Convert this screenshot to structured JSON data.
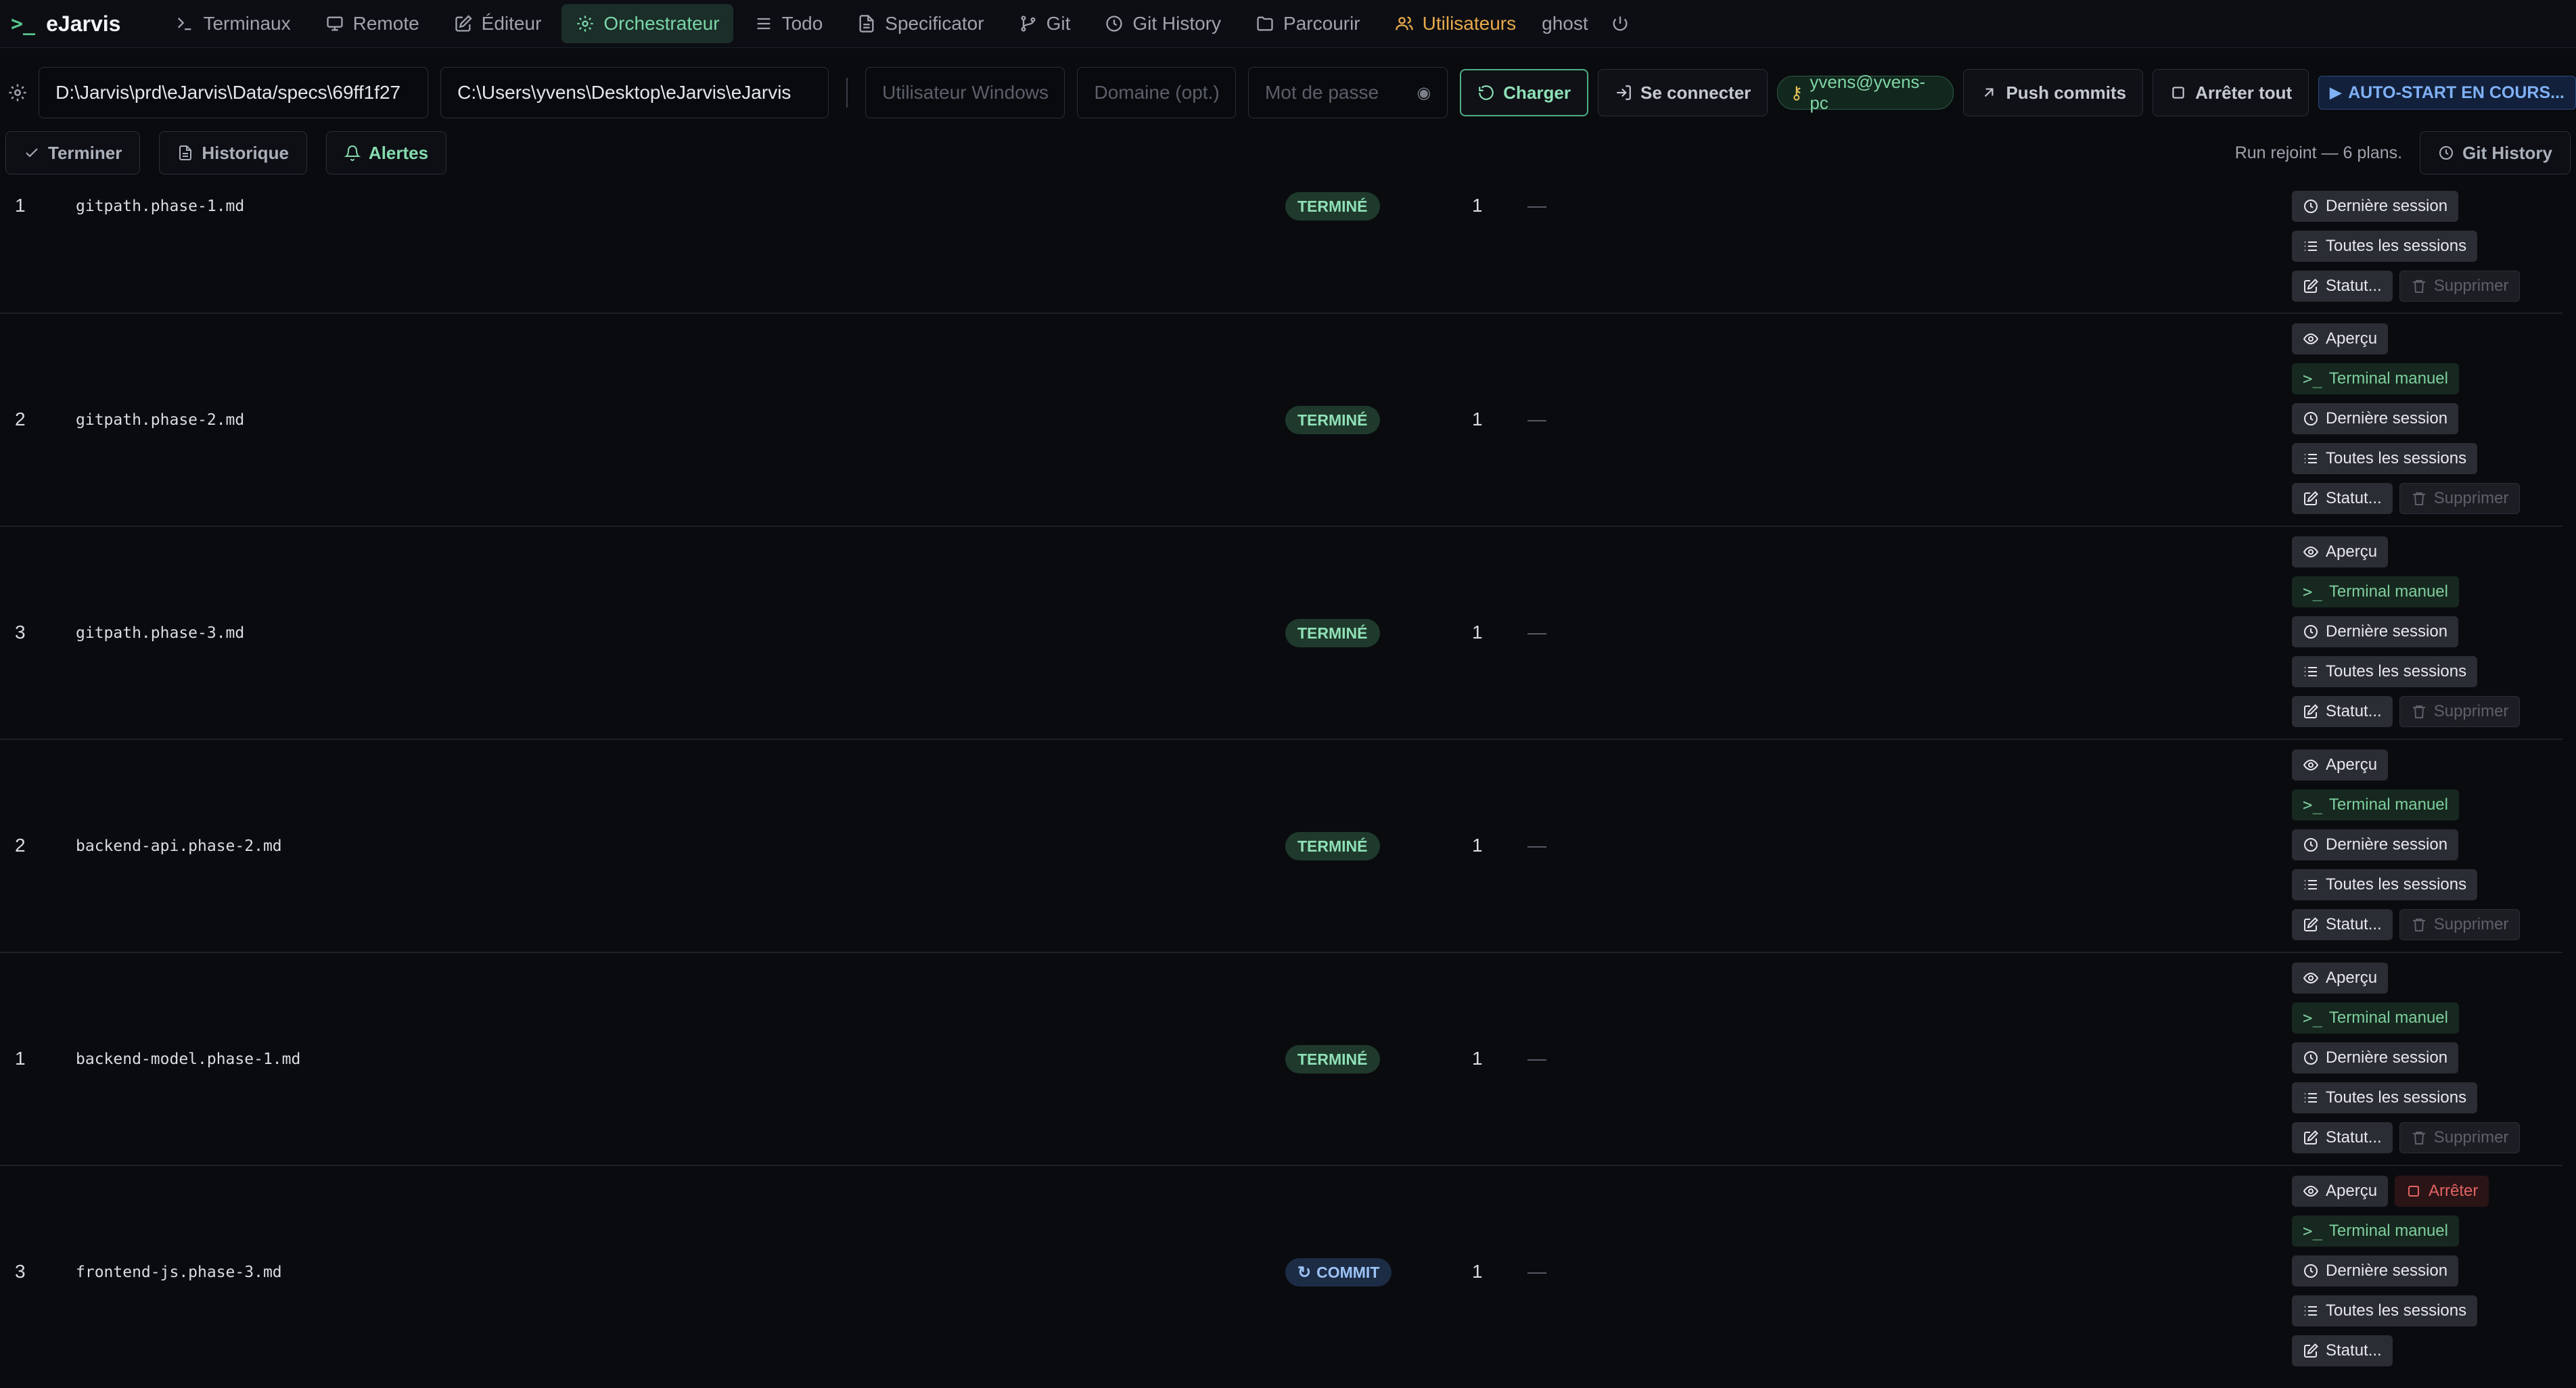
{
  "app": {
    "name": "eJarvis",
    "logo_glyph": ">_"
  },
  "nav": {
    "items": [
      {
        "label": "Terminaux",
        "icon": "terminal-icon"
      },
      {
        "label": "Remote",
        "icon": "monitor-icon"
      },
      {
        "label": "Éditeur",
        "icon": "edit-icon"
      },
      {
        "label": "Orchestrateur",
        "icon": "orchestrator-icon",
        "active": true
      },
      {
        "label": "Todo",
        "icon": "list-icon"
      },
      {
        "label": "Specificator",
        "icon": "file-icon"
      },
      {
        "label": "Git",
        "icon": "git-branch-icon"
      },
      {
        "label": "Git History",
        "icon": "clock-icon"
      },
      {
        "label": "Parcourir",
        "icon": "folder-icon"
      },
      {
        "label": "Utilisateurs",
        "icon": "users-icon"
      }
    ],
    "user": "ghost"
  },
  "toolbar": {
    "specs_path": "D:\\Jarvis\\prd\\eJarvis\\Data/specs\\69ff1f27",
    "project_path": "C:\\Users\\yvens\\Desktop\\eJarvis\\eJarvis",
    "user_placeholder": "Utilisateur Windows",
    "domain_placeholder": "Domaine (opt.)",
    "password_placeholder": "Mot de passe",
    "load_label": "Charger",
    "connect_label": "Se connecter",
    "connected_user": "yvens@yvens-pc",
    "push_label": "Push commits",
    "stop_all_label": "Arrêter tout",
    "autostart_label": "AUTO-START EN COURS..."
  },
  "subbar": {
    "finish_label": "Terminer",
    "history_label": "Historique",
    "alerts_label": "Alertes",
    "run_status": "Run rejoint — 6 plans.",
    "git_history_label": "Git History"
  },
  "action_labels": {
    "preview": "Aperçu",
    "manual_terminal": "Terminal manuel",
    "last_session": "Dernière session",
    "all_sessions": "Toutes les sessions",
    "status": "Statut...",
    "delete": "Supprimer",
    "stop": "Arrêter"
  },
  "plans": [
    {
      "num": "1",
      "file": "gitpath.phase-1.md",
      "status": "TERMINÉ",
      "count": "1",
      "extra": "—"
    },
    {
      "num": "2",
      "file": "gitpath.phase-2.md",
      "status": "TERMINÉ",
      "count": "1",
      "extra": "—"
    },
    {
      "num": "3",
      "file": "gitpath.phase-3.md",
      "status": "TERMINÉ",
      "count": "1",
      "extra": "—"
    },
    {
      "num": "2",
      "file": "backend-api.phase-2.md",
      "status": "TERMINÉ",
      "count": "1",
      "extra": "—"
    },
    {
      "num": "1",
      "file": "backend-model.phase-1.md",
      "status": "TERMINÉ",
      "count": "1",
      "extra": "—"
    },
    {
      "num": "3",
      "file": "frontend-js.phase-3.md",
      "status": "COMMIT",
      "count": "1",
      "extra": "—"
    }
  ],
  "colors": {
    "accent": "#79d7a8",
    "background": "#0a0b0f",
    "users": "#e8a94a",
    "commit": "#9cc3f6",
    "stop": "#e16363"
  }
}
